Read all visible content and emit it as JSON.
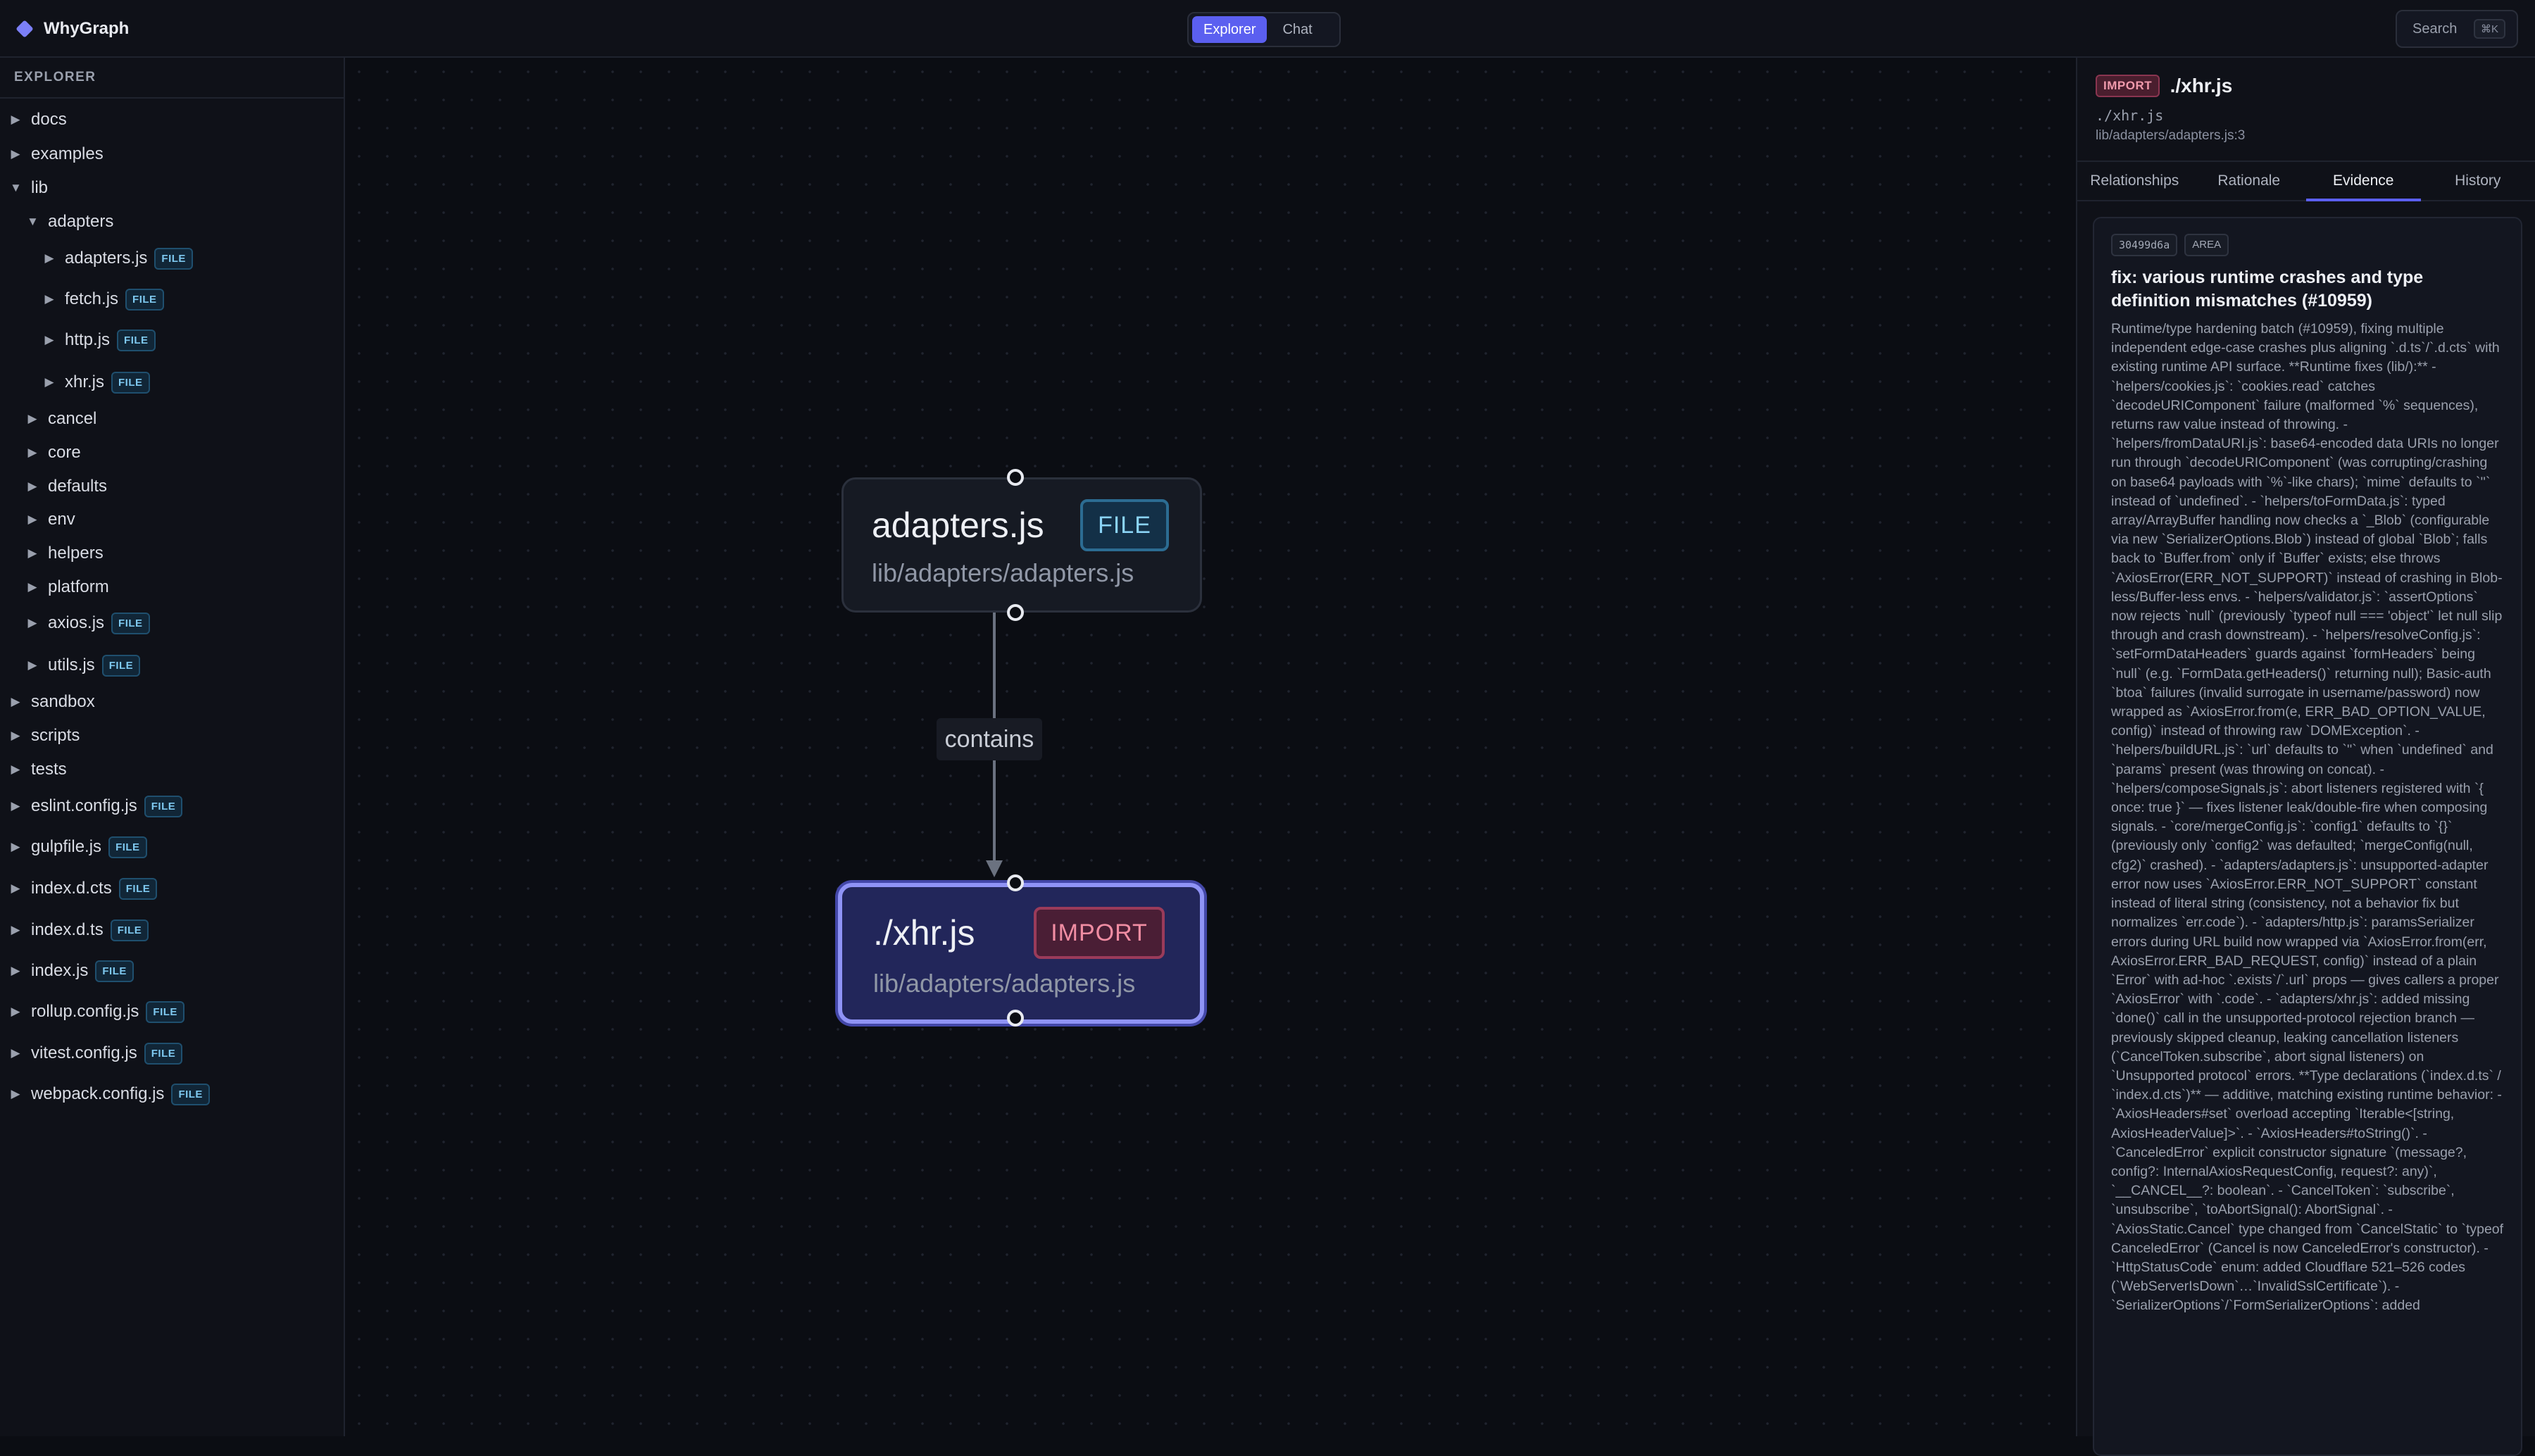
{
  "app": {
    "name": "WhyGraph"
  },
  "header": {
    "modes": [
      {
        "label": "Explorer",
        "active": true
      },
      {
        "label": "Chat",
        "active": false
      }
    ],
    "search_label": "Search",
    "search_shortcut": "⌘K"
  },
  "sidebar": {
    "title": "EXPLORER",
    "file_badge": "FILE",
    "items": [
      {
        "label": "docs",
        "caret": "▶",
        "file": false
      },
      {
        "label": "examples",
        "caret": "▶",
        "file": false
      },
      {
        "label": "lib",
        "caret": "▼",
        "file": false
      },
      {
        "label": "adapters",
        "caret": "▼",
        "file": false
      },
      {
        "label": "adapters.js",
        "caret": "▶",
        "file": true
      },
      {
        "label": "fetch.js",
        "caret": "▶",
        "file": true
      },
      {
        "label": "http.js",
        "caret": "▶",
        "file": true
      },
      {
        "label": "xhr.js",
        "caret": "▶",
        "file": true
      },
      {
        "label": "cancel",
        "caret": "▶",
        "file": false
      },
      {
        "label": "core",
        "caret": "▶",
        "file": false
      },
      {
        "label": "defaults",
        "caret": "▶",
        "file": false
      },
      {
        "label": "env",
        "caret": "▶",
        "file": false
      },
      {
        "label": "helpers",
        "caret": "▶",
        "file": false
      },
      {
        "label": "platform",
        "caret": "▶",
        "file": false
      },
      {
        "label": "axios.js",
        "caret": "▶",
        "file": true
      },
      {
        "label": "utils.js",
        "caret": "▶",
        "file": true
      },
      {
        "label": "sandbox",
        "caret": "▶",
        "file": false
      },
      {
        "label": "scripts",
        "caret": "▶",
        "file": false
      },
      {
        "label": "tests",
        "caret": "▶",
        "file": false
      },
      {
        "label": "eslint.config.js",
        "caret": "▶",
        "file": true
      },
      {
        "label": "gulpfile.js",
        "caret": "▶",
        "file": true
      },
      {
        "label": "index.d.cts",
        "caret": "▶",
        "file": true
      },
      {
        "label": "index.d.ts",
        "caret": "▶",
        "file": true
      },
      {
        "label": "index.js",
        "caret": "▶",
        "file": true
      },
      {
        "label": "rollup.config.js",
        "caret": "▶",
        "file": true
      },
      {
        "label": "vitest.config.js",
        "caret": "▶",
        "file": true
      },
      {
        "label": "webpack.config.js",
        "caret": "▶",
        "file": true
      }
    ]
  },
  "graph": {
    "source_node": {
      "title": "adapters.js",
      "badge": "FILE",
      "path": "lib/adapters/adapters.js"
    },
    "target_node": {
      "title": "./xhr.js",
      "badge": "IMPORT",
      "path": "lib/adapters/adapters.js"
    },
    "edge_label": "contains"
  },
  "details": {
    "badge": "IMPORT",
    "title": "./xhr.js",
    "subtitle": "./xhr.js",
    "location": "lib/adapters/adapters.js:3",
    "tabs": [
      {
        "label": "Relationships",
        "active": false
      },
      {
        "label": "Rationale",
        "active": false
      },
      {
        "label": "Evidence",
        "active": true
      },
      {
        "label": "History",
        "active": false
      }
    ],
    "evidence": {
      "commit": "30499d6a",
      "tag": "AREA",
      "title": "fix: various runtime crashes and type definition mismatches (#10959)",
      "body": "Runtime/type hardening batch (#10959), fixing multiple independent edge-case crashes plus aligning `.d.ts`/`.d.cts` with existing runtime API surface. **Runtime fixes (lib/):** - `helpers/cookies.js`: `cookies.read` catches `decodeURIComponent` failure (malformed `%` sequences), returns raw value instead of throwing. - `helpers/fromDataURI.js`: base64-encoded data URIs no longer run through `decodeURIComponent` (was corrupting/crashing on base64 payloads with `%`-like chars); `mime` defaults to `''` instead of `undefined`. - `helpers/toFormData.js`: typed array/ArrayBuffer handling now checks a `_Blob` (configurable via new `SerializerOptions.Blob`) instead of global `Blob`; falls back to `Buffer.from` only if `Buffer` exists; else throws `AxiosError(ERR_NOT_SUPPORT)` instead of crashing in Blob-less/Buffer-less envs. - `helpers/validator.js`: `assertOptions` now rejects `null` (previously `typeof null === 'object'` let null slip through and crash downstream). - `helpers/resolveConfig.js`: `setFormDataHeaders` guards against `formHeaders` being `null` (e.g. `FormData.getHeaders()` returning null); Basic-auth `btoa` failures (invalid surrogate in username/password) now wrapped as `AxiosError.from(e, ERR_BAD_OPTION_VALUE, config)` instead of throwing raw `DOMException`. - `helpers/buildURL.js`: `url` defaults to `''` when `undefined` and `params` present (was throwing on concat). - `helpers/composeSignals.js`: abort listeners registered with `{ once: true }` — fixes listener leak/double-fire when composing signals. - `core/mergeConfig.js`: `config1` defaults to `{}` (previously only `config2` was defaulted; `mergeConfig(null, cfg2)` crashed). - `adapters/adapters.js`: unsupported-adapter error now uses `AxiosError.ERR_NOT_SUPPORT` constant instead of literal string (consistency, not a behavior fix but normalizes `err.code`). - `adapters/http.js`: paramsSerializer errors during URL build now wrapped via `AxiosError.from(err, AxiosError.ERR_BAD_REQUEST, config)` instead of a plain `Error` with ad-hoc `.exists`/`.url` props — gives callers a proper `AxiosError` with `.code`. - `adapters/xhr.js`: added missing `done()` call in the unsupported-protocol rejection branch — previously skipped cleanup, leaking cancellation listeners (`CancelToken.subscribe`, abort signal listeners) on `Unsupported protocol` errors. **Type declarations (`index.d.ts` / `index.d.cts`)** — additive, matching existing runtime behavior: - `AxiosHeaders#set` overload accepting `Iterable<[string, AxiosHeaderValue]>`. - `AxiosHeaders#toString()`. - `CanceledError` explicit constructor signature `(message?, config?: InternalAxiosRequestConfig, request?: any)`, `__CANCEL__?: boolean`. - `CancelToken`: `subscribe`, `unsubscribe`, `toAbortSignal(): AbortSignal`. - `AxiosStatic.Cancel` type changed from `CancelStatic` to `typeof CanceledError` (Cancel is now CanceledError's constructor). - `HttpStatusCode` enum: added Cloudflare 521–526 codes (`WebServerIsDown`…`InvalidSslCertificate`). - `SerializerOptions`/`FormSerializerOptions`: added"
    }
  }
}
